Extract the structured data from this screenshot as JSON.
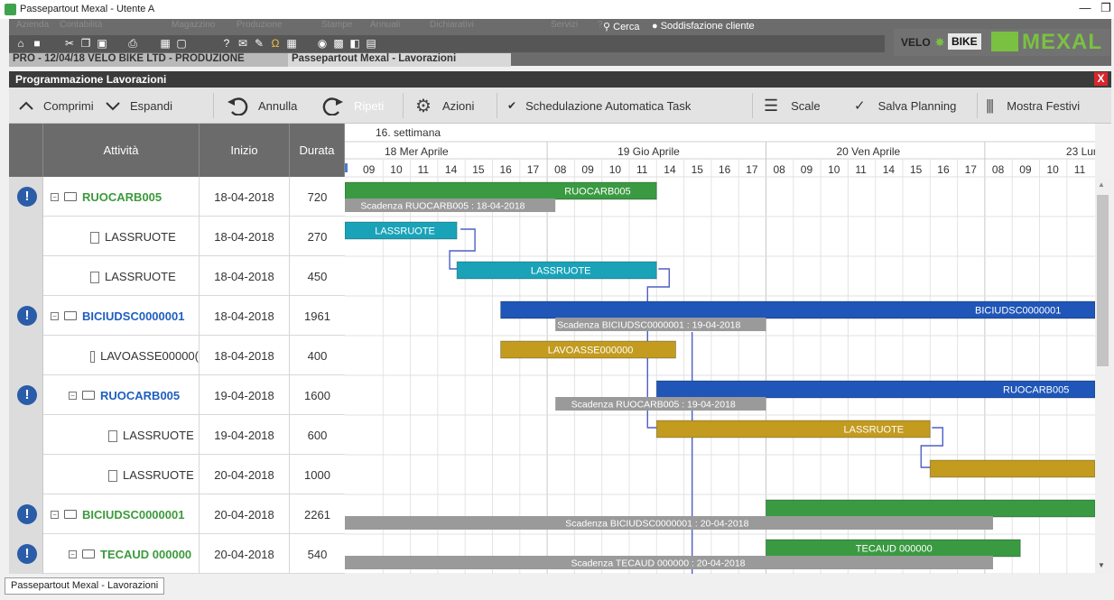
{
  "window": {
    "title": "Passepartout Mexal - Utente A",
    "minimize": "—",
    "restore": "❐"
  },
  "menu": [
    "Azienda",
    "Contabilità",
    "Magazzino",
    "Produzione",
    "Stampe",
    "Annuali",
    "Dichiarativi",
    "Servizi",
    "?"
  ],
  "top": {
    "search": "Cerca",
    "satisfaction": "Soddisfazione cliente",
    "logo_left": "VELO",
    "logo_right": "BIKE",
    "logo_mexal": "MEXAL"
  },
  "breadcrumb": {
    "context": "PRO - 12/04/18  VELO BIKE LTD - PRODUZIONE",
    "active_tab": "Passepartout Mexal - Lavorazioni"
  },
  "panel": {
    "title": "Programmazione Lavorazioni",
    "close": "X"
  },
  "toolbar": {
    "collapse": "Comprimi",
    "expand": "Espandi",
    "undo": "Annulla",
    "redo": "Ripeti",
    "actions": "Azioni",
    "auto_schedule": "Schedulazione Automatica Task",
    "scale": "Scale",
    "save": "Salva Planning",
    "holidays": "Mostra Festivi"
  },
  "columns": {
    "activity": "Attività",
    "start": "Inizio",
    "duration": "Durata"
  },
  "rows": [
    {
      "name": "RUOCARB005",
      "start": "18-04-2018",
      "duration": "720",
      "level": 0,
      "alert": true,
      "type": "parent",
      "color": "#3c9a3c"
    },
    {
      "name": "LASSRUOTE",
      "start": "18-04-2018",
      "duration": "270",
      "level": 1,
      "alert": false,
      "type": "child",
      "color": "#333333"
    },
    {
      "name": "LASSRUOTE",
      "start": "18-04-2018",
      "duration": "450",
      "level": 1,
      "alert": false,
      "type": "child",
      "color": "#333333"
    },
    {
      "name": "BICIUDSC0000001",
      "start": "18-04-2018",
      "duration": "1961",
      "level": 0,
      "alert": true,
      "type": "parent",
      "color": "#1f5fbf"
    },
    {
      "name": "LAVOASSE00000(",
      "start": "18-04-2018",
      "duration": "400",
      "level": 1,
      "alert": false,
      "type": "child",
      "color": "#333333"
    },
    {
      "name": "RUOCARB005",
      "start": "19-04-2018",
      "duration": "1600",
      "level": 0.5,
      "alert": true,
      "type": "parent",
      "color": "#1f5fbf"
    },
    {
      "name": "LASSRUOTE",
      "start": "19-04-2018",
      "duration": "600",
      "level": 1.5,
      "alert": false,
      "type": "child",
      "color": "#333333"
    },
    {
      "name": "LASSRUOTE",
      "start": "20-04-2018",
      "duration": "1000",
      "level": 1.5,
      "alert": false,
      "type": "child",
      "color": "#333333"
    },
    {
      "name": "BICIUDSC0000001",
      "start": "20-04-2018",
      "duration": "2261",
      "level": 0,
      "alert": true,
      "type": "parent",
      "color": "#3c9a3c"
    },
    {
      "name": "TECAUD 000000",
      "start": "20-04-2018",
      "duration": "540",
      "level": 0.5,
      "alert": true,
      "type": "parent",
      "color": "#3c9a3c"
    }
  ],
  "timeline": {
    "week": "16. settimana",
    "days": [
      {
        "label": "18 Mer Aprile",
        "hours": [
          "09",
          "10",
          "11",
          "14",
          "15",
          "16",
          "17"
        ]
      },
      {
        "label": "19 Gio Aprile",
        "hours": [
          "08",
          "09",
          "10",
          "11",
          "14",
          "15",
          "16",
          "17"
        ]
      },
      {
        "label": "20 Ven Aprile",
        "hours": [
          "08",
          "09",
          "10",
          "11",
          "14",
          "15",
          "16",
          "17"
        ]
      },
      {
        "label": "23 Lun",
        "hours": [
          "08",
          "09",
          "10",
          "11"
        ]
      }
    ]
  },
  "bars": [
    {
      "row": 0,
      "from": 0,
      "to": 11,
      "color": "#3a9a42",
      "label": "RUOCARB005",
      "kind": "task"
    },
    {
      "row": 0,
      "from": 0,
      "to": 7.3,
      "color": "#9a9a9a",
      "label": "Scadenza RUOCARB005 : 18-04-2018",
      "kind": "due"
    },
    {
      "row": 1,
      "from": 0,
      "to": 3.7,
      "color": "#1aa3b8",
      "label": "LASSRUOTE",
      "kind": "task"
    },
    {
      "row": 2,
      "from": 3.7,
      "to": 11,
      "color": "#1aa3b8",
      "label": "LASSRUOTE",
      "kind": "task"
    },
    {
      "row": 3,
      "from": 5.3,
      "to": 27.3,
      "color": "#1f56b8",
      "label": "BICIUDSC0000001",
      "kind": "task"
    },
    {
      "row": 3,
      "from": 7.3,
      "to": 15,
      "color": "#9a9a9a",
      "label": "Scadenza BICIUDSC0000001 : 19-04-2018",
      "kind": "due"
    },
    {
      "row": 4,
      "from": 5.3,
      "to": 11.7,
      "color": "#c29b1f",
      "label": "LAVOASSE000000",
      "kind": "task"
    },
    {
      "row": 5,
      "from": 11,
      "to": 27.3,
      "color": "#1f56b8",
      "label": "RUOCARB005",
      "kind": "task"
    },
    {
      "row": 5,
      "from": 7.3,
      "to": 15,
      "color": "#9a9a9a",
      "label": "Scadenza RUOCARB005 : 19-04-2018",
      "kind": "due"
    },
    {
      "row": 6,
      "from": 11,
      "to": 21,
      "color": "#c29b1f",
      "label": "LASSRUOTE",
      "kind": "task"
    },
    {
      "row": 7,
      "from": 21,
      "to": 27.3,
      "color": "#c29b1f",
      "label": "",
      "kind": "task"
    },
    {
      "row": 8,
      "from": 15,
      "to": 27.3,
      "color": "#3a9a42",
      "label": "",
      "kind": "task"
    },
    {
      "row": 8,
      "from": 0,
      "to": 23.3,
      "color": "#9a9a9a",
      "label": "Scadenza BICIUDSC0000001 : 20-04-2018",
      "kind": "due"
    },
    {
      "row": 9,
      "from": 15,
      "to": 24.3,
      "color": "#3a9a42",
      "label": "TECAUD 000000",
      "kind": "task"
    },
    {
      "row": 9,
      "from": 0,
      "to": 23.3,
      "color": "#9a9a9a",
      "label": "Scadenza TECAUD 000000 : 20-04-2018",
      "kind": "due"
    }
  ],
  "status_tab": "Passepartout Mexal - Lavorazioni"
}
